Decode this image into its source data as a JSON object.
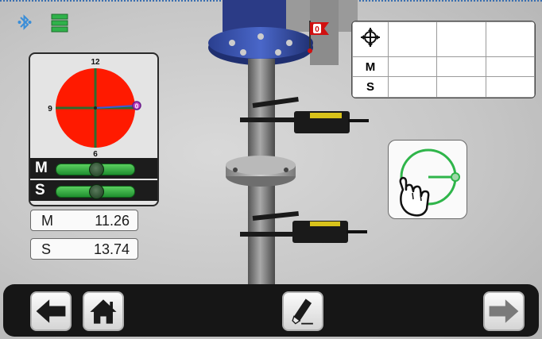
{
  "status": {
    "icons": [
      "bluetooth-icon",
      "battery-icon"
    ]
  },
  "gauge": {
    "labels": {
      "top": "12",
      "left": "9",
      "bottom": "6"
    },
    "target_label": "0",
    "disc_color": "#ff1a00",
    "needle_color": "#2e6b2e"
  },
  "levels": [
    {
      "letter": "M",
      "bubble_position": 0.5
    },
    {
      "letter": "S",
      "bubble_position": 0.5
    }
  ],
  "readings": [
    {
      "label": "M",
      "value": "11.26"
    },
    {
      "label": "S",
      "value": "13.74"
    }
  ],
  "flag": {
    "number": "0"
  },
  "results_table": {
    "header_icon": "crosshair-icon",
    "rows": [
      {
        "label": "",
        "cells": [
          "",
          "",
          ""
        ]
      },
      {
        "label": "M",
        "cells": [
          "",
          "",
          ""
        ]
      },
      {
        "label": "S",
        "cells": [
          "",
          "",
          ""
        ]
      }
    ]
  },
  "rotate_action": {
    "icon": "hand-rotate-icon"
  },
  "nav": {
    "back": "arrow-left-icon",
    "home": "home-icon",
    "edit": "pen-icon",
    "next": "arrow-right-icon"
  }
}
